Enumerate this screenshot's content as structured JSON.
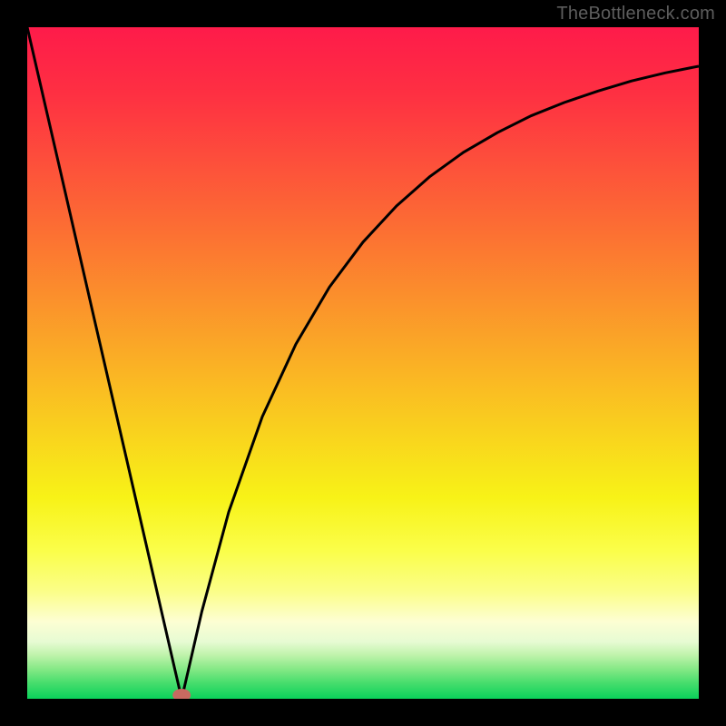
{
  "watermark": "TheBottleneck.com",
  "chart_data": {
    "type": "line",
    "title": "",
    "xlabel": "",
    "ylabel": "",
    "xlim": [
      0,
      100
    ],
    "ylim": [
      0,
      100
    ],
    "grid": false,
    "legend": false,
    "x_min_at": 23,
    "series": [
      {
        "name": "bottleneck-curve",
        "x": [
          0,
          5,
          10,
          15,
          20,
          22,
          23,
          24,
          26,
          30,
          35,
          40,
          45,
          50,
          55,
          60,
          65,
          70,
          75,
          80,
          85,
          90,
          95,
          100
        ],
        "values": [
          100,
          78.3,
          56.5,
          34.8,
          13.0,
          4.3,
          0,
          4.3,
          13.0,
          27.8,
          42.0,
          52.8,
          61.3,
          68.0,
          73.4,
          77.8,
          81.4,
          84.3,
          86.8,
          88.8,
          90.5,
          92.0,
          93.2,
          94.2
        ]
      }
    ],
    "marker": {
      "x": 23,
      "y": 0,
      "color": "#c76a61"
    },
    "background": {
      "type": "vertical-gradient",
      "stops": [
        {
          "pos": 0.0,
          "color": "#fe1b4a"
        },
        {
          "pos": 0.1,
          "color": "#fe3042"
        },
        {
          "pos": 0.2,
          "color": "#fd4f3b"
        },
        {
          "pos": 0.3,
          "color": "#fc6e33"
        },
        {
          "pos": 0.4,
          "color": "#fb8f2c"
        },
        {
          "pos": 0.5,
          "color": "#fab025"
        },
        {
          "pos": 0.6,
          "color": "#f9d11e"
        },
        {
          "pos": 0.7,
          "color": "#f8f217"
        },
        {
          "pos": 0.78,
          "color": "#fafe4a"
        },
        {
          "pos": 0.84,
          "color": "#fbfe88"
        },
        {
          "pos": 0.885,
          "color": "#fdfed3"
        },
        {
          "pos": 0.915,
          "color": "#e7fbd3"
        },
        {
          "pos": 0.935,
          "color": "#bff3ab"
        },
        {
          "pos": 0.955,
          "color": "#87e987"
        },
        {
          "pos": 0.975,
          "color": "#4bde6e"
        },
        {
          "pos": 1.0,
          "color": "#0ad15a"
        }
      ]
    }
  }
}
